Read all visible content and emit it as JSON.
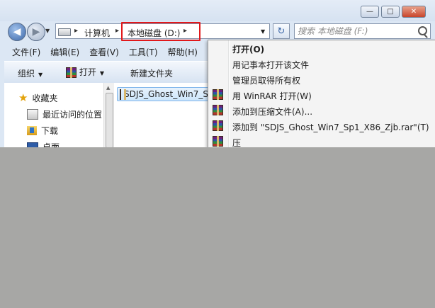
{
  "window": {
    "caption_buttons": {
      "minimize": "—",
      "maximize": "□",
      "close": "✕"
    }
  },
  "nav": {
    "back_icon": "back-arrow-icon",
    "forward_icon": "forward-arrow-icon"
  },
  "address": {
    "crumbs": [
      "计算机",
      "本地磁盘 (D:)"
    ],
    "separator": "▸",
    "refresh_glyph": "↻"
  },
  "search": {
    "placeholder": "搜索 本地磁盘 (F:)"
  },
  "menubar": {
    "items": [
      "文件(F)",
      "编辑(E)",
      "查看(V)",
      "工具(T)",
      "帮助(H)"
    ]
  },
  "toolbar": {
    "organize": "组织",
    "open": "打开",
    "new_folder": "新建文件夹"
  },
  "sidebar": {
    "items": [
      "收藏夹",
      "最近访问的位置",
      "下载",
      "桌面"
    ]
  },
  "content": {
    "file_name": "SDJS_Ghost_Win7_Sp1_X86_Zjb.rar"
  },
  "context_menu": {
    "items": [
      {
        "label": "打开(O)",
        "bold": true,
        "icon": "none"
      },
      {
        "label": "用记事本打开该文件",
        "icon": "none"
      },
      {
        "label": "管理员取得所有权",
        "icon": "none"
      },
      {
        "label": "用 WinRAR 打开(W)",
        "icon": "winrar-icon"
      },
      {
        "label": "添加到压缩文件(A)...",
        "icon": "winrar-icon"
      },
      {
        "label": "添加到 \"SDJS_Ghost_Win7_Sp1_X86_Zjb.rar\"(T)",
        "icon": "winrar-icon"
      },
      {
        "label": "压",
        "icon": "winrar-icon"
      }
    ]
  },
  "colors": {
    "highlight_box": "#e1181b",
    "background_fill": "#a7a7a5"
  }
}
